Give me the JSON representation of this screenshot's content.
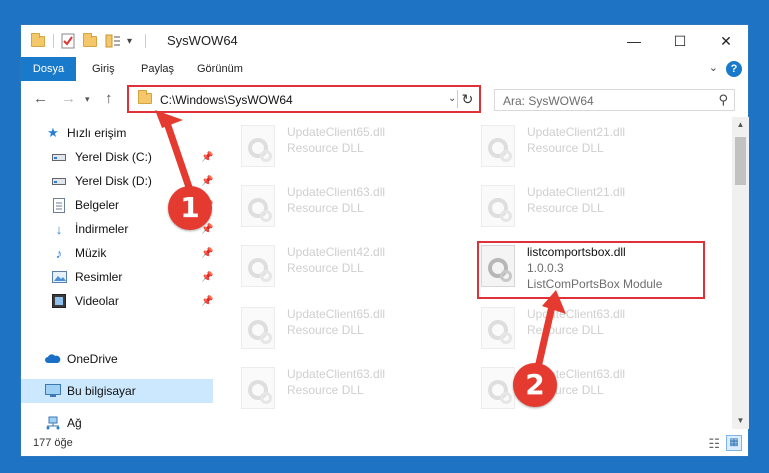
{
  "window": {
    "title": "SysWOW64",
    "quick_access_dropdown": "▾",
    "minimize": "—",
    "maximize": "☐",
    "close": "✕"
  },
  "ribbon": {
    "tabs": [
      "Dosya",
      "Giriş",
      "Paylaş",
      "Görünüm"
    ],
    "help": "?"
  },
  "nav": {
    "address": "C:\\Windows\\SysWOW64",
    "search_placeholder": "Ara: SysWOW64"
  },
  "sidebar": {
    "items": [
      {
        "label": "Hızlı erişim",
        "icon": "star-icon",
        "pinned": false
      },
      {
        "label": "Yerel Disk (C:)",
        "icon": "drive-icon",
        "pinned": true
      },
      {
        "label": "Yerel Disk (D:)",
        "icon": "drive-icon",
        "pinned": true
      },
      {
        "label": "Belgeler",
        "icon": "documents-icon",
        "pinned": true
      },
      {
        "label": "İndirmeler",
        "icon": "download-icon",
        "pinned": true
      },
      {
        "label": "Müzik",
        "icon": "music-icon",
        "pinned": true
      },
      {
        "label": "Resimler",
        "icon": "pictures-icon",
        "pinned": true
      },
      {
        "label": "Videolar",
        "icon": "video-icon",
        "pinned": true
      },
      {
        "label": "OneDrive",
        "icon": "cloud-icon",
        "pinned": false
      },
      {
        "label": "Bu bilgisayar",
        "icon": "computer-icon",
        "pinned": false,
        "selected": true
      },
      {
        "label": "Ağ",
        "icon": "network-icon",
        "pinned": false
      }
    ]
  },
  "files": [
    {
      "name": "UpdateClient65.dll",
      "type": "Resource DLL",
      "dim": true
    },
    {
      "name": "UpdateClient21.dll",
      "type": "Resource DLL",
      "dim": true
    },
    {
      "name": "UpdateClient63.dll",
      "type": "Resource DLL",
      "dim": true
    },
    {
      "name": "UpdateClient21.dll",
      "type": "Resource DLL",
      "dim": true
    },
    {
      "name": "UpdateClient42.dll",
      "type": "Resource DLL",
      "dim": true
    },
    {
      "name": "listcomportsbox.dll",
      "version": "1.0.0.3",
      "type": "ListComPortsBox Module",
      "dim": false,
      "highlighted": true
    },
    {
      "name": "UpdateClient65.dll",
      "type": "Resource DLL",
      "dim": true
    },
    {
      "name": "UpdateClient63.dll",
      "type": "Resource DLL",
      "dim": true
    },
    {
      "name": "UpdateClient63.dll",
      "type": "Resource DLL",
      "dim": true
    },
    {
      "name": "UpdateClient63.dll",
      "type": "Resource DLL",
      "dim": true
    }
  ],
  "status": {
    "item_count": "177 öğe"
  },
  "callouts": [
    "1",
    "2"
  ],
  "colors": {
    "accent": "#1979ca",
    "highlight": "#e0313a",
    "callout": "#e53a2f",
    "selection": "#cce8ff"
  }
}
